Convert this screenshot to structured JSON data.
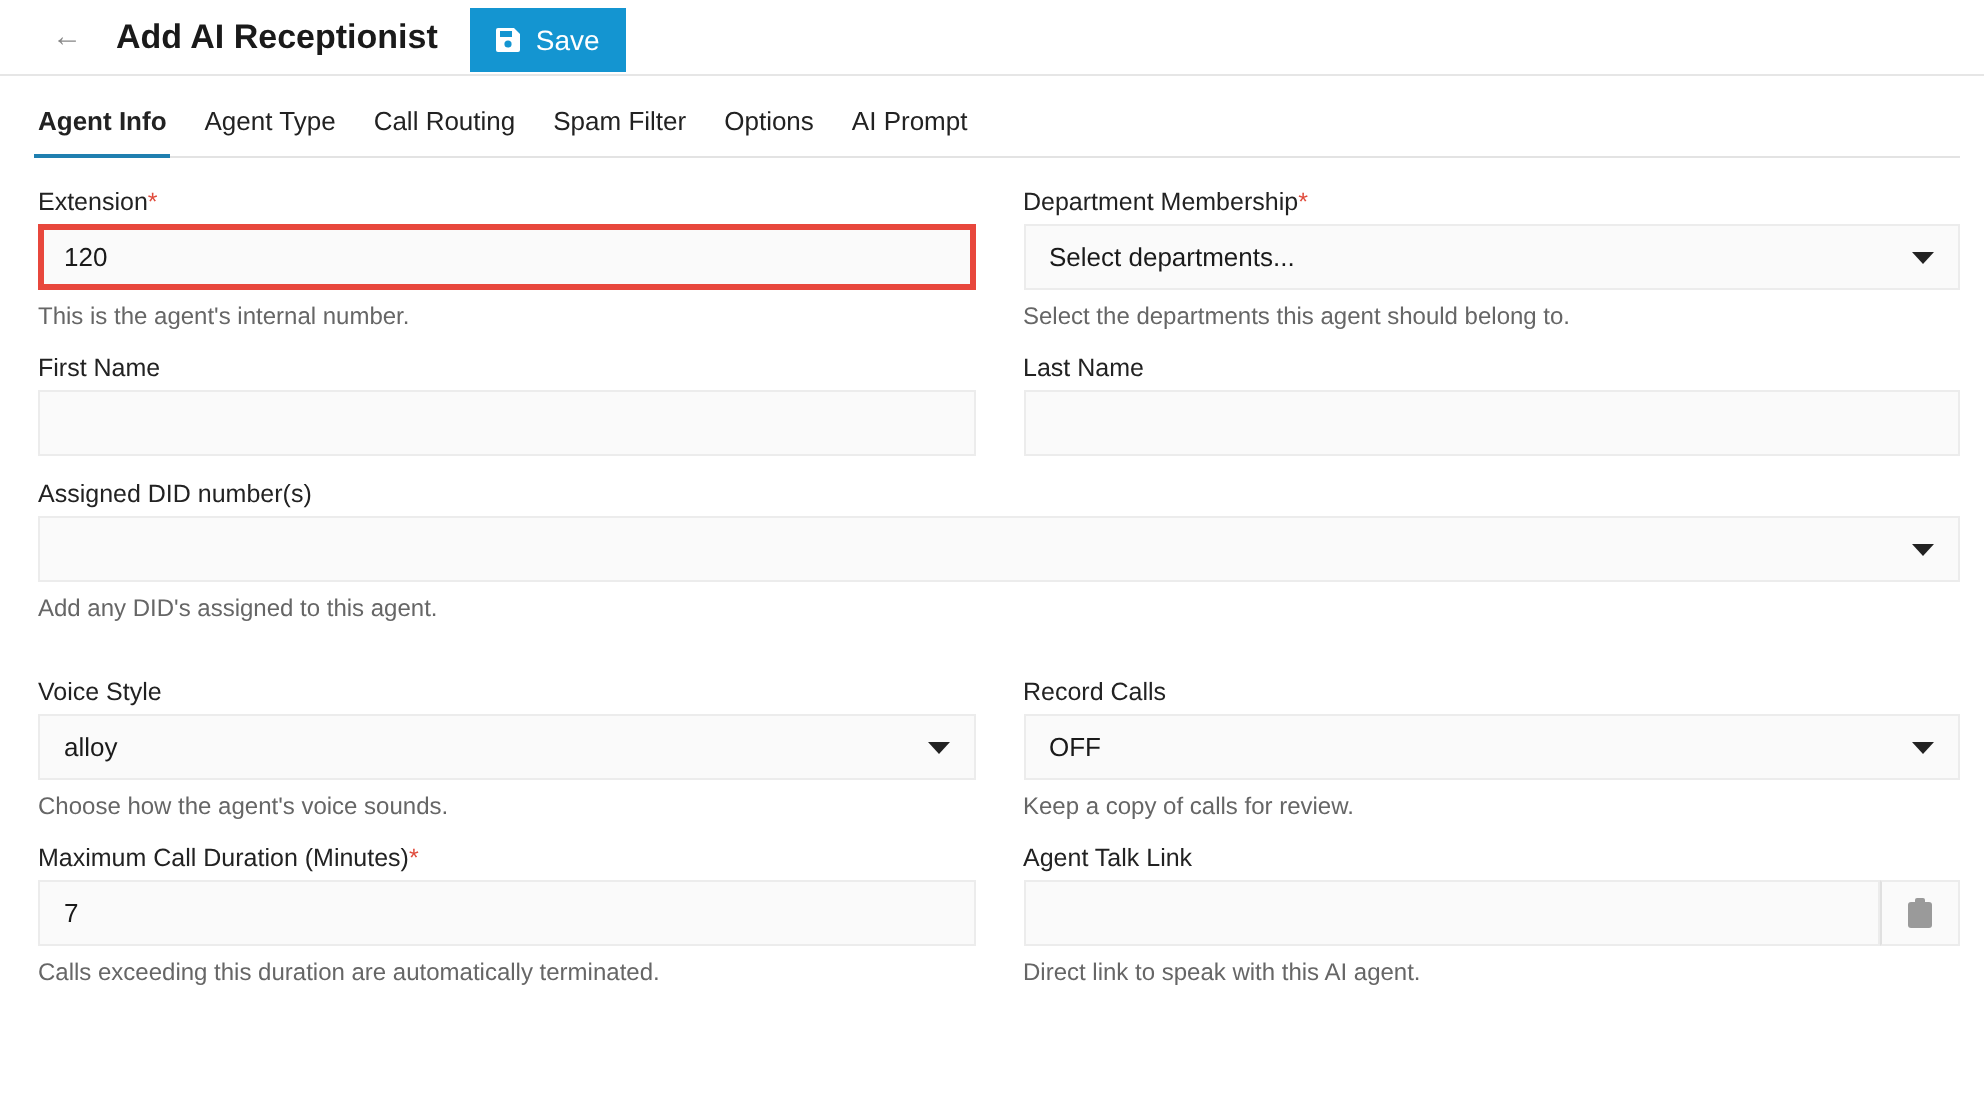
{
  "header": {
    "back": "←",
    "title": "Add AI Receptionist",
    "save_button": "Save"
  },
  "tabs": [
    {
      "label": "Agent Info",
      "selected": true
    },
    {
      "label": "Agent Type",
      "selected": false
    },
    {
      "label": "Call Routing",
      "selected": false
    },
    {
      "label": "Spam Filter",
      "selected": false
    },
    {
      "label": "Options",
      "selected": false
    },
    {
      "label": "AI Prompt",
      "selected": false
    }
  ],
  "sections": [
    {
      "rows": [
        {
          "fields": [
            {
              "kind": "input",
              "label": "Extension",
              "required_mark": "*",
              "value": "120",
              "highlighted": true,
              "help": "This is the agent's internal number."
            },
            {
              "kind": "select",
              "label": "Department Membership",
              "required_mark": "*",
              "placeholder": "Select departments...",
              "highlighted": false,
              "help": "Select the departments this agent should belong to."
            }
          ]
        },
        {
          "fields": [
            {
              "kind": "input",
              "label": "First Name",
              "highlighted": false
            },
            {
              "kind": "input",
              "label": "Last Name",
              "highlighted": false
            }
          ]
        },
        {
          "fields": [
            {
              "kind": "select",
              "label": "Assigned DID number(s)",
              "highlighted": false,
              "help": "Add any DID's assigned to this agent."
            }
          ]
        }
      ]
    },
    {
      "rows": [
        {
          "fields": [
            {
              "kind": "select",
              "label": "Voice Style",
              "value": "alloy",
              "highlighted": false,
              "help": "Choose how the agent's voice sounds."
            },
            {
              "kind": "select",
              "label": "Record Calls",
              "value": "OFF",
              "highlighted": false,
              "help": "Keep a copy of calls for review."
            }
          ]
        },
        {
          "fields": [
            {
              "kind": "input",
              "label": "Maximum Call Duration (Minutes)",
              "required_mark": "*",
              "value": "7",
              "highlighted": false,
              "help": "Calls exceeding this duration are automatically terminated."
            },
            {
              "kind": "copy",
              "label": "Agent Talk Link",
              "highlighted": false,
              "help": "Direct link to speak with this AI agent."
            }
          ]
        }
      ]
    }
  ]
}
